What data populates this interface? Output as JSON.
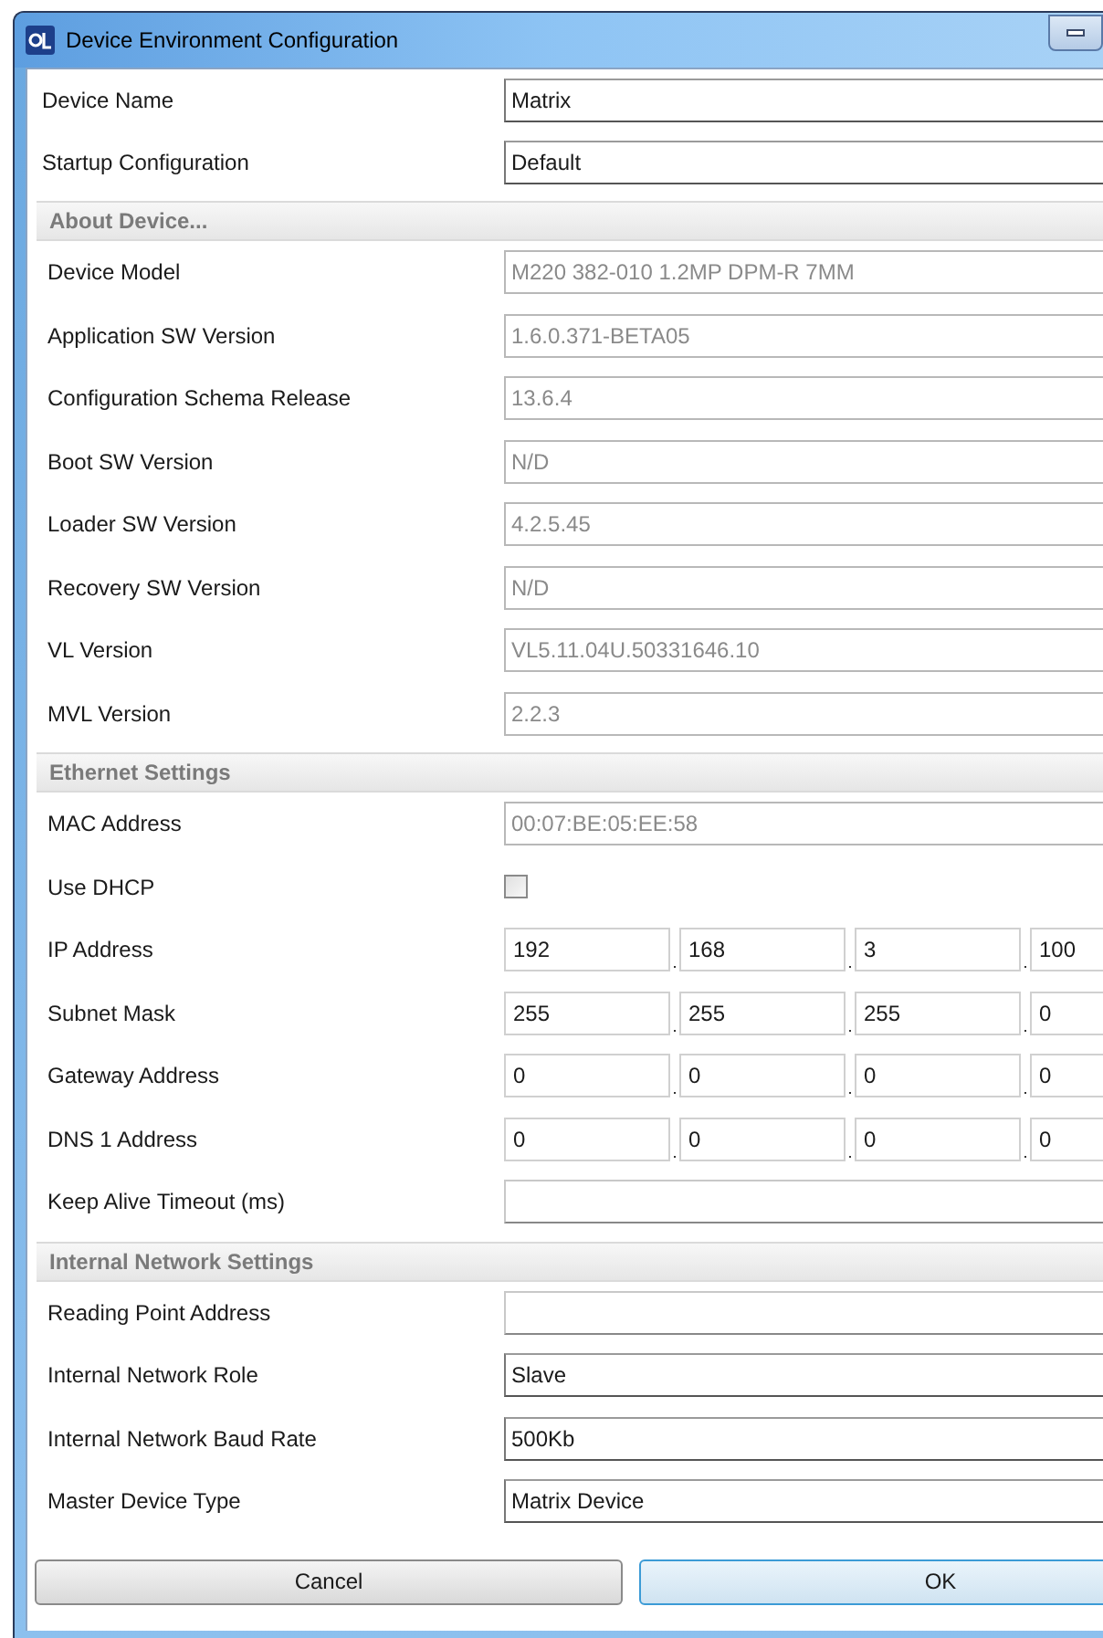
{
  "window": {
    "title": "Device Environment Configuration"
  },
  "groups": [
    {
      "rows": [
        {
          "label": "Device Name",
          "kind": "text",
          "value": "Matrix"
        },
        {
          "label": "Startup Configuration",
          "kind": "text",
          "value": "Default"
        }
      ]
    },
    {
      "title": "About Device...",
      "rows": [
        {
          "label": "Device Model",
          "kind": "readonly",
          "value": "M220 382-010 1.2MP DPM-R 7MM"
        },
        {
          "label": "Application SW Version",
          "kind": "readonly",
          "value": "1.6.0.371-BETA05"
        },
        {
          "label": "Configuration Schema Release",
          "kind": "readonly",
          "value": "13.6.4"
        },
        {
          "label": "Boot SW Version",
          "kind": "readonly",
          "value": "N/D"
        },
        {
          "label": "Loader SW Version",
          "kind": "readonly",
          "value": "4.2.5.45"
        },
        {
          "label": "Recovery SW Version",
          "kind": "readonly",
          "value": "N/D"
        },
        {
          "label": "VL Version",
          "kind": "readonly",
          "value": "VL5.11.04U.50331646.10"
        },
        {
          "label": "MVL Version",
          "kind": "readonly",
          "value": "2.2.3"
        }
      ]
    },
    {
      "title": "Ethernet Settings",
      "rows": [
        {
          "label": "MAC Address",
          "kind": "readonly",
          "value": "00:07:BE:05:EE:58"
        },
        {
          "label": "Use DHCP",
          "kind": "checkbox",
          "checked": false
        },
        {
          "label": "IP Address",
          "kind": "ip",
          "octets": [
            "192",
            "168",
            "3",
            "100"
          ]
        },
        {
          "label": "Subnet Mask",
          "kind": "ip",
          "octets": [
            "255",
            "255",
            "255",
            "0"
          ]
        },
        {
          "label": "Gateway Address",
          "kind": "ip",
          "octets": [
            "0",
            "0",
            "0",
            "0"
          ]
        },
        {
          "label": "DNS 1 Address",
          "kind": "ip",
          "octets": [
            "0",
            "0",
            "0",
            "0"
          ]
        },
        {
          "label": "Keep Alive Timeout (ms)",
          "kind": "blank"
        }
      ]
    },
    {
      "title": "Internal Network Settings",
      "rows": [
        {
          "label": "Reading Point Address",
          "kind": "blank"
        },
        {
          "label": "Internal Network Role",
          "kind": "text",
          "value": "Slave"
        },
        {
          "label": "Internal Network Baud Rate",
          "kind": "text",
          "value": "500Kb"
        },
        {
          "label": "Master Device Type",
          "kind": "text",
          "value": "Matrix Device"
        }
      ]
    }
  ],
  "buttons": [
    {
      "label": "Cancel",
      "default": false
    },
    {
      "label": "OK",
      "default": true
    }
  ]
}
